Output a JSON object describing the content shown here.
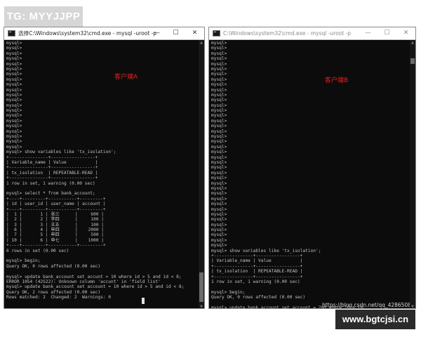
{
  "watermark_top": "TG: MYYJJPP",
  "watermark_bottom": "www.bgtcjsi.cn",
  "left_window": {
    "title": "选择C:\\Windows\\system32\\cmd.exe - mysql  -uroot -p",
    "label": "客户端A",
    "lines": [
      "mysql>",
      "mysql>",
      "mysql>",
      "mysql>",
      "mysql>",
      "mysql>",
      "mysql>",
      "mysql>",
      "mysql>",
      "mysql>",
      "mysql>",
      "mysql>",
      "mysql>",
      "mysql>",
      "mysql>",
      "mysql>",
      "mysql>",
      "mysql>",
      "mysql>",
      "mysql>",
      "mysql>",
      "mysql> show variables like 'tx_isolation';",
      "+---------------+-----------------+",
      "| Variable_name | Value           |",
      "+---------------+-----------------+",
      "| tx_isolation  | REPEATABLE-READ |",
      "+---------------+-----------------+",
      "1 row in set, 1 warning (0.00 sec)",
      "",
      "mysql> select * from bank_account;",
      "+----+---------+-----------+---------+",
      "| id | user_id | user_name | account |",
      "+----+---------+-----------+---------+",
      "|  1 |       1 | 张三      |     600 |",
      "|  2 |       2 | 李四      |     100 |",
      "|  3 |       3 | 王五      |     100 |",
      "|  6 |       4 | 申四      |    2000 |",
      "|  7 |       5 | 申四      |     500 |",
      "| 10 |       6 | 申七      |    1000 |",
      "+----+---------+-----------+---------+",
      "6 rows in set (0.00 sec)",
      "",
      "mysql> begin;",
      "Query OK, 0 rows affected (0.00 sec)",
      "",
      "mysql> update bank_account set accunt = 10 where id > 5 and id < 8;",
      "ERROR 1054 (42S22): Unknown column 'accunt' in 'field list'",
      "mysql> update bank_account set account = 10 where id > 5 and id < 8;",
      "Query OK, 2 rows affected (0.00 sec)",
      "Rows matched: 2  Changed: 2  Warnings: 0",
      "",
      "",
      "",
      "mysql>"
    ]
  },
  "right_window": {
    "title": "C:\\Windows\\system32\\cmd.exe - mysql  -uroot -p",
    "label": "客户端B",
    "lines": [
      "mysql>",
      "mysql>",
      "mysql>",
      "mysql>",
      "mysql>",
      "mysql>",
      "mysql>",
      "mysql>",
      "mysql>",
      "mysql>",
      "mysql>",
      "mysql>",
      "mysql>",
      "mysql>",
      "mysql>",
      "mysql>",
      "mysql>",
      "mysql>",
      "mysql>",
      "mysql>",
      "mysql>",
      "mysql>",
      "mysql>",
      "mysql>",
      "mysql>",
      "mysql>",
      "mysql>",
      "mysql>",
      "mysql>",
      "mysql>",
      "mysql>",
      "mysql>",
      "mysql>",
      "mysql>",
      "mysql>",
      "mysql>",
      "mysql>",
      "mysql>",
      "mysql>",
      "mysql>",
      "mysql> show variables like 'tx_isolation';",
      "+---------------+-----------------+",
      "| Variable_name | Value           |",
      "+---------------+-----------------+",
      "| tx_isolation  | REPEATABLE-READ |",
      "+---------------+-----------------+",
      "1 row in set, 1 warning (0.00 sec)",
      "",
      "mysql> begin;",
      "Query OK, 0 rows affected (0.00 sec)",
      "",
      "mysql> update bank_account set account = 200 where id = 10;"
    ],
    "csdn_watermark": "https://blog.csdn.net/qq_4286508"
  },
  "window_controls": {
    "minimize": "—",
    "maximize": "☐",
    "close": "✕"
  }
}
